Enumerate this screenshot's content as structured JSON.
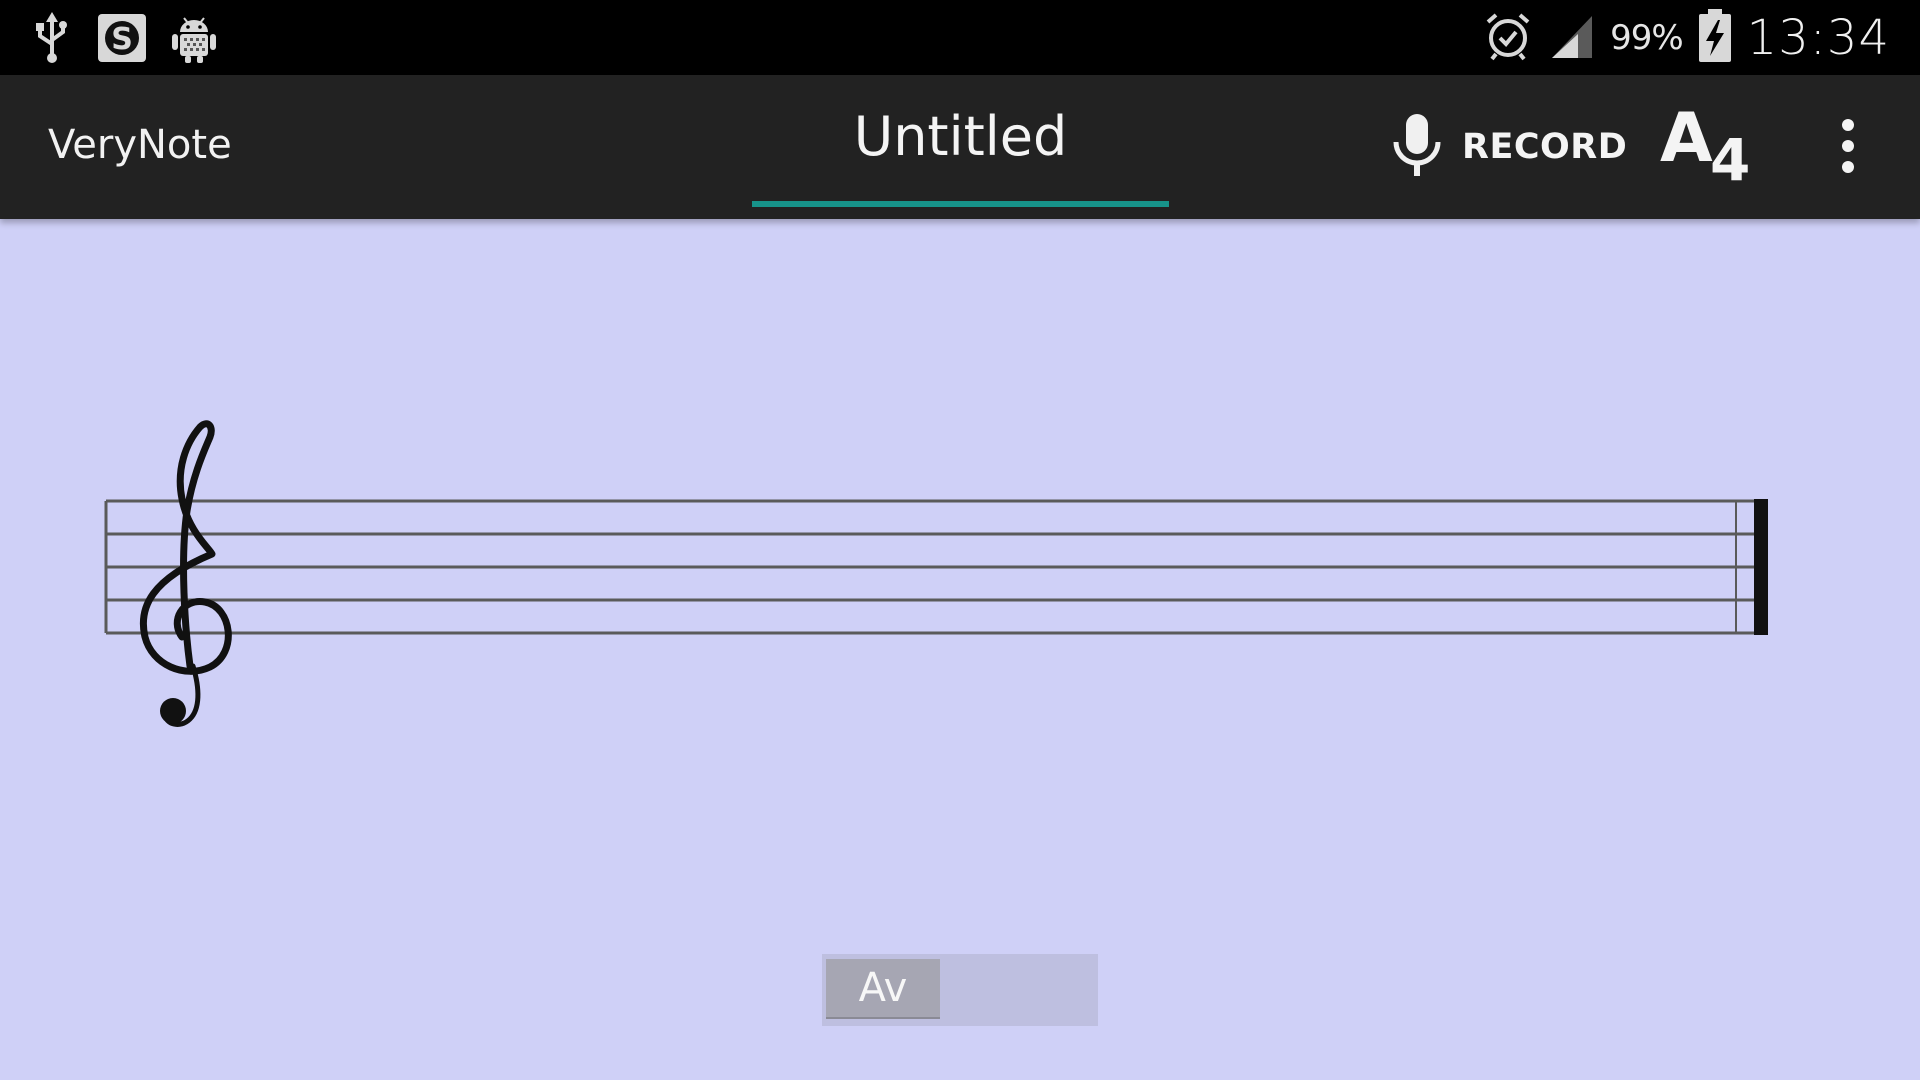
{
  "status_bar": {
    "left_icons": [
      "usb-icon",
      "s-badge-icon",
      "android-debug-icon"
    ],
    "right_icons": [
      "alarm-icon",
      "signal-icon",
      "battery-charging-icon"
    ],
    "battery_percent": "99%",
    "clock": "13:34"
  },
  "action_bar": {
    "app_name": "VeryNote",
    "tab": {
      "label": "Untitled",
      "indicator_color": "#17938a"
    },
    "record": {
      "icon": "microphone-icon",
      "label": "RECORD"
    },
    "pitch": {
      "note": "A",
      "octave": "4"
    },
    "overflow_icon": "more-vertical-icon"
  },
  "staff": {
    "clef": "treble-clef-icon",
    "lines": 5,
    "end_barline": "final-barline"
  },
  "bottom_control": {
    "button_label": "Av"
  },
  "colors": {
    "background": "#cfd0f7",
    "action_bar": "#222222",
    "status_bar": "#000000",
    "accent": "#17938a"
  }
}
